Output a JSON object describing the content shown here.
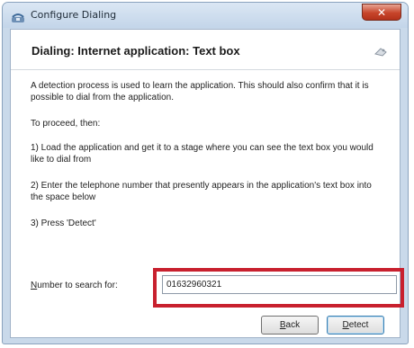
{
  "window": {
    "title": "Configure Dialing",
    "close_glyph": "✕",
    "app_icon": "phone-dialer-icon"
  },
  "header": {
    "heading": "Dialing: Internet application: Text box",
    "wizard_icon": "wizard-hat-icon"
  },
  "body": {
    "intro": "A detection process is used to learn the application. This should also confirm that it is possible to dial from the application.",
    "proceed": "To proceed, then:",
    "step1": "1) Load the application and get it to a stage where you can see the text box you would like to dial from",
    "step2": "2) Enter the telephone number that presently appears in the application's text box into the space below",
    "step3": "3) Press 'Detect'"
  },
  "search": {
    "label_access": "N",
    "label_rest": "umber to search for:",
    "value": "01632960321"
  },
  "buttons": {
    "back_access": "B",
    "back_rest": "ack",
    "detect_access": "D",
    "detect_rest": "etect"
  },
  "colors": {
    "highlight": "#c8202e",
    "close_button": "#c7452b",
    "frame": "#c9d9ea"
  }
}
